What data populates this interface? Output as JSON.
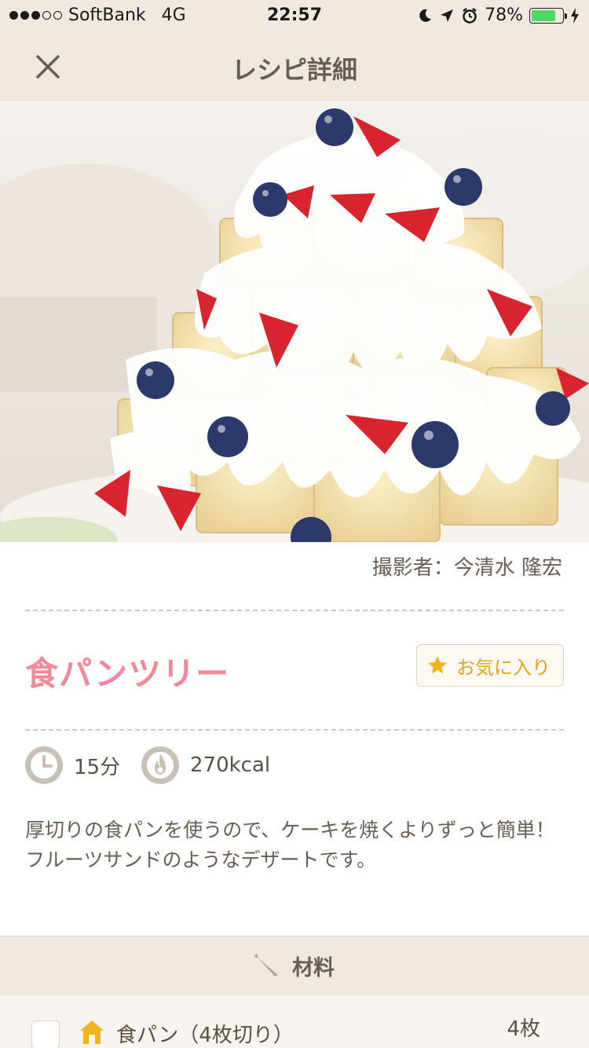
{
  "status_bar": {
    "carrier": "SoftBank",
    "network": "4G",
    "time": "22:57",
    "battery": "78%",
    "battery_level": 0.78,
    "signal_bars_filled": 3,
    "signal_bars_total": 5
  },
  "nav": {
    "title": "レシピ詳細",
    "close_icon": "close-icon"
  },
  "hero": {
    "icon": "strawberry-blueberry-bread-tree-photo"
  },
  "photographer": "撮影者：今清水 隆宏",
  "recipe": {
    "title": "食パンツリー",
    "favorite_label": "お気に入り",
    "time": "15分",
    "calories": "270kcal",
    "description": "厚切りの食パンを使うので、ケーキを焼くよりずっと簡単！フルーツサンドのようなデザートです。"
  },
  "ingredients": {
    "header": "材料",
    "items": [
      {
        "name": "食パン（4枚切り）",
        "quantity": "4枚"
      }
    ]
  },
  "colors": {
    "accent": "#f08a98",
    "favorite": "#e0a422",
    "header_bg": "#f1e9df",
    "battery": "#4cd964"
  }
}
